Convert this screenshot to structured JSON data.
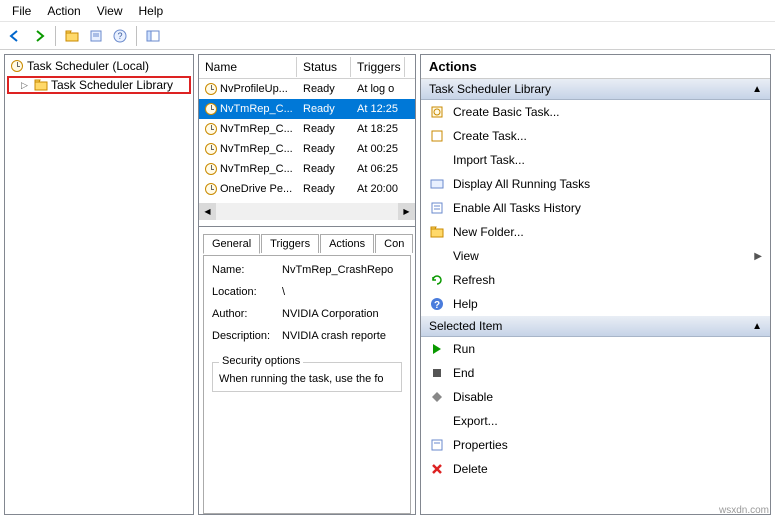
{
  "menu": {
    "file": "File",
    "action": "Action",
    "view": "View",
    "help": "Help"
  },
  "tree": {
    "root": "Task Scheduler (Local)",
    "lib": "Task Scheduler Library"
  },
  "taskList": {
    "columns": {
      "name": "Name",
      "status": "Status",
      "triggers": "Triggers"
    },
    "rows": [
      {
        "name": "NvProfileUp...",
        "status": "Ready",
        "trigger": "At log o"
      },
      {
        "name": "NvTmRep_C...",
        "status": "Ready",
        "trigger": "At 12:25"
      },
      {
        "name": "NvTmRep_C...",
        "status": "Ready",
        "trigger": "At 18:25"
      },
      {
        "name": "NvTmRep_C...",
        "status": "Ready",
        "trigger": "At 00:25"
      },
      {
        "name": "NvTmRep_C...",
        "status": "Ready",
        "trigger": "At 06:25"
      },
      {
        "name": "OneDrive Pe...",
        "status": "Ready",
        "trigger": "At 20:00"
      }
    ]
  },
  "tabs": {
    "general": "General",
    "triggers": "Triggers",
    "actions": "Actions",
    "conditions": "Con"
  },
  "details": {
    "nameLabel": "Name:",
    "nameValue": "NvTmRep_CrashRepo",
    "locationLabel": "Location:",
    "locationValue": "\\",
    "authorLabel": "Author:",
    "authorValue": "NVIDIA Corporation",
    "descriptionLabel": "Description:",
    "descriptionValue": "NVIDIA crash reporte",
    "securityLegend": "Security options",
    "securityText": "When running the task, use the fo"
  },
  "actionsPanel": {
    "title": "Actions",
    "groupLib": "Task Scheduler Library",
    "groupItem": "Selected Item",
    "libItems": {
      "createBasic": "Create Basic Task...",
      "createTask": "Create Task...",
      "importTask": "Import Task...",
      "displayAll": "Display All Running Tasks",
      "enableHistory": "Enable All Tasks History",
      "newFolder": "New Folder...",
      "view": "View",
      "refresh": "Refresh",
      "help": "Help"
    },
    "itemItems": {
      "run": "Run",
      "end": "End",
      "disable": "Disable",
      "export": "Export...",
      "properties": "Properties",
      "delete": "Delete"
    }
  },
  "watermark": "wsxdn.com"
}
